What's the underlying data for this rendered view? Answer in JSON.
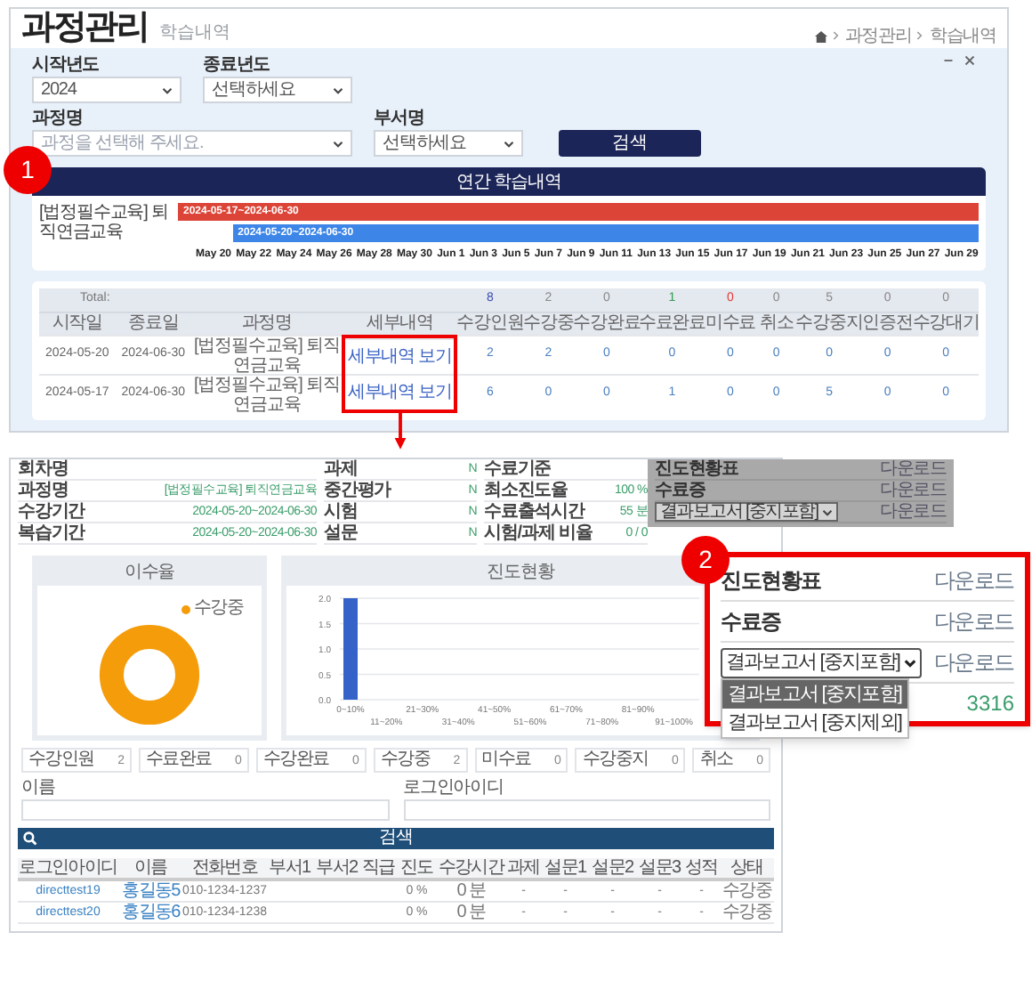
{
  "header": {
    "title": "과정관리",
    "subtitle": "학습내역",
    "breadcrumb": [
      "과정관리",
      "학습내역"
    ]
  },
  "filters": [
    {
      "label": "시작년도",
      "value": "2024"
    },
    {
      "label": "종료년도",
      "value": "선택하세요"
    },
    {
      "label": "과정명",
      "placeholder": "과정을 선택해 주세요."
    },
    {
      "label": "부서명",
      "value": "선택하세요"
    }
  ],
  "search_button": "검색",
  "callouts": [
    "1",
    "2"
  ],
  "gantt": {
    "title": "연간 학습내역",
    "row_label": "[법정필수교육] 퇴직연금교육",
    "bars": [
      {
        "label": "2024-05-17~2024-06-30",
        "color": "#dc4437"
      },
      {
        "label": "2024-05-20~2024-06-30",
        "color": "#3d86e8"
      }
    ],
    "axis": [
      "May 20",
      "May 22",
      "May 24",
      "May 26",
      "May 28",
      "May 30",
      "Jun 1",
      "Jun 3",
      "Jun 5",
      "Jun 7",
      "Jun 9",
      "Jun 11",
      "Jun 13",
      "Jun 15",
      "Jun 17",
      "Jun 19",
      "Jun 21",
      "Jun 23",
      "Jun 25",
      "Jun 27",
      "Jun 29"
    ]
  },
  "summary_table": {
    "total_label": "Total:",
    "totals": [
      {
        "text": "8",
        "color": "#3f51b5"
      },
      {
        "text": "2",
        "color": "#888888"
      },
      {
        "text": "0",
        "color": "#888888"
      },
      {
        "text": "1",
        "color": "#2e9b4e"
      },
      {
        "text": "0",
        "color": "#e53935"
      },
      {
        "text": "0",
        "color": "#888888"
      },
      {
        "text": "5",
        "color": "#888888"
      },
      {
        "text": "0",
        "color": "#888888"
      },
      {
        "text": "0",
        "color": "#888888"
      }
    ],
    "columns": [
      "시작일",
      "종료일",
      "과정명",
      "세부내역",
      "수강인원",
      "수강중",
      "수강완료",
      "수료완료",
      "미수료",
      "취소",
      "수강중지",
      "인증전",
      "수강대기"
    ],
    "rows": [
      [
        "2024-05-20",
        "2024-06-30",
        "[법정필수교육] 퇴직연금교육",
        "세부내역 보기",
        "2",
        "2",
        "0",
        "0",
        "0",
        "0",
        "0",
        "0",
        "0"
      ],
      [
        "2024-05-17",
        "2024-06-30",
        "[법정필수교육] 퇴직연금교육",
        "세부내역 보기",
        "6",
        "0",
        "0",
        "1",
        "0",
        "0",
        "5",
        "0",
        "0"
      ]
    ]
  },
  "detail": {
    "info": [
      [
        {
          "label": "회차명"
        },
        {
          "label": "과정명",
          "value": "[법정필수교육] 퇴직연금교육"
        },
        {
          "label": "수강기간",
          "value": "2024-05-20~2024-06-30"
        },
        {
          "label": "복습기간",
          "value": "2024-05-20~2024-06-30"
        }
      ],
      [
        {
          "label": "과제",
          "value": "N"
        },
        {
          "label": "중간평가",
          "value": "N"
        },
        {
          "label": "시험",
          "value": "N"
        },
        {
          "label": "설문",
          "value": "N"
        }
      ],
      [
        {
          "label": "수료기준"
        },
        {
          "label": "최소진도율",
          "value": "100 %"
        },
        {
          "label": "수료출석시간",
          "value": "55 분"
        },
        {
          "label": "시험/과제 비율",
          "value": "0 / 0"
        }
      ]
    ],
    "downloads": [
      {
        "kind": "text",
        "label": "진도현황표",
        "action": "다운로드"
      },
      {
        "kind": "text",
        "label": "수료증",
        "action": "다운로드"
      },
      {
        "kind": "select",
        "label": "결과보고서 [중지포함]",
        "action": "다운로드"
      }
    ],
    "completion_chart": {
      "title": "이수율",
      "legend": [
        {
          "label": "수강중",
          "color": "#f59c0b"
        }
      ]
    },
    "progress_chart": {
      "title": "진도현황",
      "chart_data": {
        "type": "bar",
        "categories": [
          "0~10%",
          "11~20%",
          "21~30%",
          "31~40%",
          "41~50%",
          "51~60%",
          "61~70%",
          "71~80%",
          "81~90%",
          "91~100%"
        ],
        "grid": true,
        "series": [
          {
            "color": "#3462c9",
            "values": [
              2,
              0,
              0,
              0,
              0,
              0,
              0,
              0,
              0,
              0
            ]
          }
        ],
        "ylim": [
          0,
          2
        ],
        "yticks": [
          {
            "value": 0,
            "label": "0.0"
          },
          {
            "value": 0.5,
            "label": "0.5"
          },
          {
            "value": 1,
            "label": "1.0"
          },
          {
            "value": 1.5,
            "label": "1.5"
          },
          {
            "value": 2,
            "label": "2.0"
          }
        ]
      }
    },
    "stats": [
      {
        "label": "수강인원",
        "value": "2"
      },
      {
        "label": "수료완료",
        "value": "0"
      },
      {
        "label": "수강완료",
        "value": "0"
      },
      {
        "label": "수강중",
        "value": "2"
      },
      {
        "label": "미수료",
        "value": "0"
      },
      {
        "label": "수강중지",
        "value": "0"
      },
      {
        "label": "취소",
        "value": "0"
      }
    ],
    "search_fields": [
      {
        "label": "이름"
      },
      {
        "label": "로그인아이디"
      }
    ],
    "search_bar": "검색",
    "members": {
      "columns": [
        "로그인아이디",
        "이름",
        "전화번호",
        "부서1",
        "부서2",
        "직급",
        "진도",
        "수강시간",
        "과제",
        "설문1",
        "설문2",
        "설문3",
        "성적",
        "상태"
      ],
      "rows": [
        [
          "directtest19",
          "홍길동5",
          "010-1234-1237",
          null,
          null,
          null,
          "0 %",
          "0 분",
          "-",
          "-",
          "-",
          "-",
          "-",
          "수강중"
        ],
        [
          "directtest20",
          "홍길동6",
          "010-1234-1238",
          null,
          null,
          null,
          "0 %",
          "0 분",
          "-",
          "-",
          "-",
          "-",
          "-",
          "수강중"
        ]
      ]
    }
  },
  "zoom_popup": {
    "rows": [
      {
        "kind": "text",
        "label": "진도현황표",
        "action": "다운로드"
      },
      {
        "kind": "text",
        "label": "수료증",
        "action": "다운로드"
      },
      {
        "kind": "select",
        "label": "결과보고서 [중지포함]",
        "action": "다운로드"
      }
    ],
    "options": [
      {
        "text": "결과보고서 [중지포함]",
        "selected": true
      },
      {
        "text": "결과보고서 [중지제외]",
        "selected": false
      }
    ],
    "number": "3316"
  }
}
